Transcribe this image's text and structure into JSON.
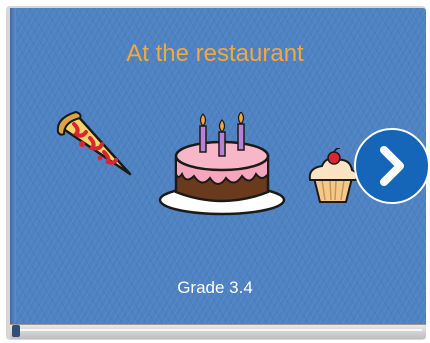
{
  "book": {
    "title": "At the restaurant",
    "subtitle": "Grade 3.4"
  },
  "illustrations": [
    "pizza-slice",
    "birthday-cake",
    "cupcake"
  ],
  "navigation": {
    "next_icon": "chevron-right-icon"
  },
  "colors": {
    "cover": "#4f82c3",
    "title": "#f2a93b",
    "subtitle": "#ffffff",
    "next_button": "#1565b8"
  }
}
